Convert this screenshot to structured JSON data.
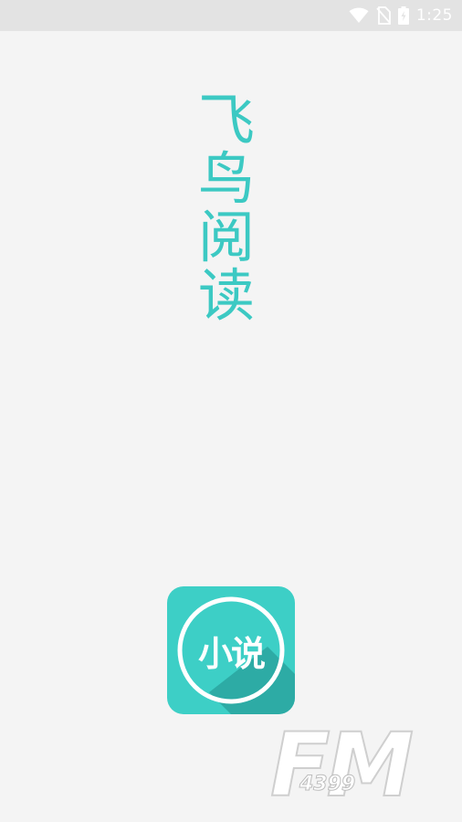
{
  "status_bar": {
    "time": "1:25",
    "icons": [
      "wifi-icon",
      "no-sim-icon",
      "battery-charging-icon"
    ]
  },
  "splash": {
    "title_chars": [
      "飞",
      "鸟",
      "阅",
      "读"
    ],
    "logo_text": "小说"
  },
  "watermark": {
    "letters": "FM",
    "number": "4399"
  },
  "colors": {
    "accent": "#3cc9c3",
    "logo_bg": "#3dcfc6",
    "logo_shadow": "#2aa59f",
    "background": "#f4f4f4",
    "status_bar_bg": "#e3e3e3"
  }
}
